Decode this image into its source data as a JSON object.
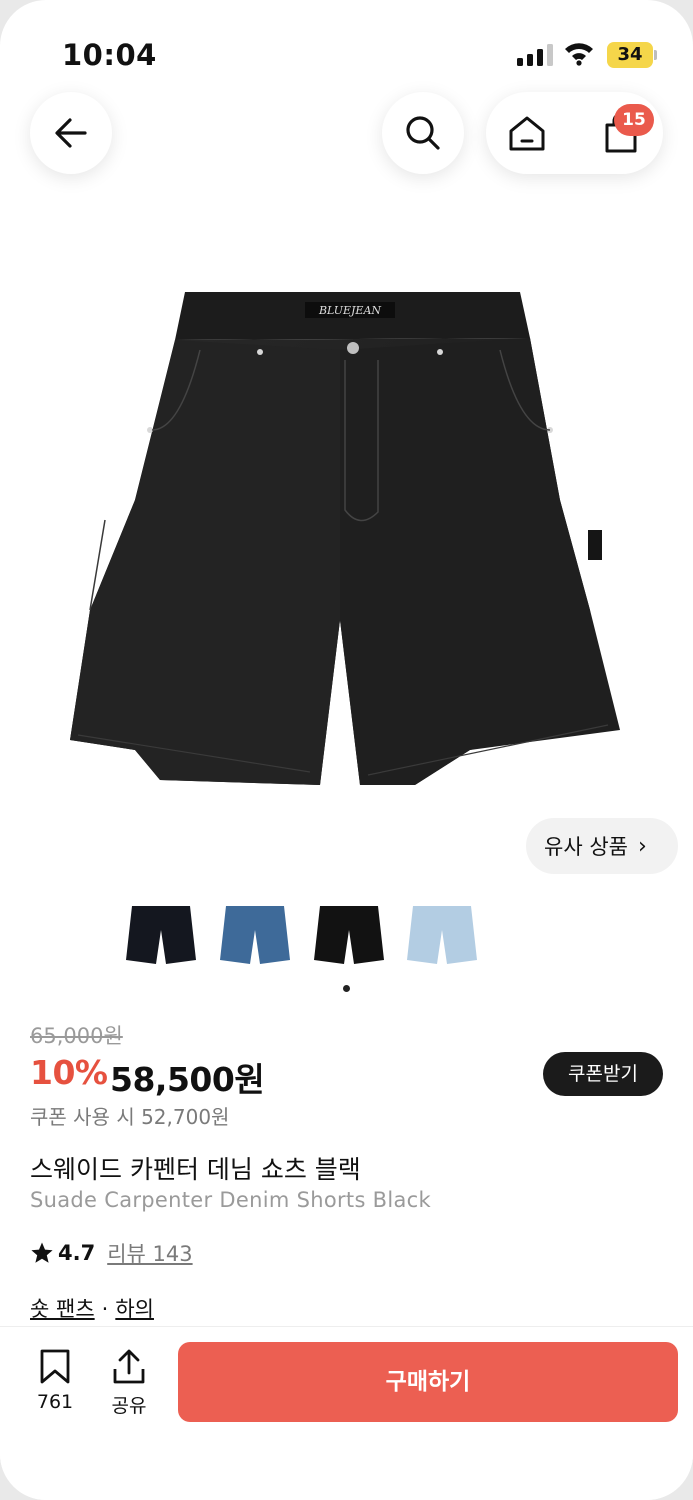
{
  "status_bar": {
    "time": "10:04",
    "battery": "34"
  },
  "nav": {
    "back_icon": "arrow-left-icon",
    "search_icon": "search-icon",
    "home_icon": "home-icon",
    "cart_icon": "shopping-bag-icon",
    "cart_count": "15"
  },
  "gallery": {
    "similar_label": "유사 상품",
    "similar_chevron": "›",
    "thumbnails": [
      "black-denim-shorts",
      "blue-denim-shorts",
      "black-denim-shorts-alt",
      "light-blue-denim-shorts"
    ]
  },
  "price": {
    "original": "65,000원",
    "discount": "10%",
    "sale": "58,500원",
    "coupon_price": "쿠폰 사용 시 52,700원",
    "coupon_button": "쿠폰받기"
  },
  "product": {
    "name_ko": "스웨이드 카펜터 데님 쇼츠 블랙",
    "name_en": "Suade Carpenter Denim Shorts Black",
    "rating": "4.7",
    "review_label": "리뷰 143",
    "categories": [
      "숏 팬츠",
      "하의"
    ],
    "category_separator": "·"
  },
  "bottom_bar": {
    "bookmark_count": "761",
    "share_label": "공유",
    "buy_label": "구매하기"
  },
  "colors": {
    "accent": "#ec5f52",
    "discount": "#e6513f",
    "badge": "#ea5a4c",
    "battery": "#f5d64a"
  }
}
